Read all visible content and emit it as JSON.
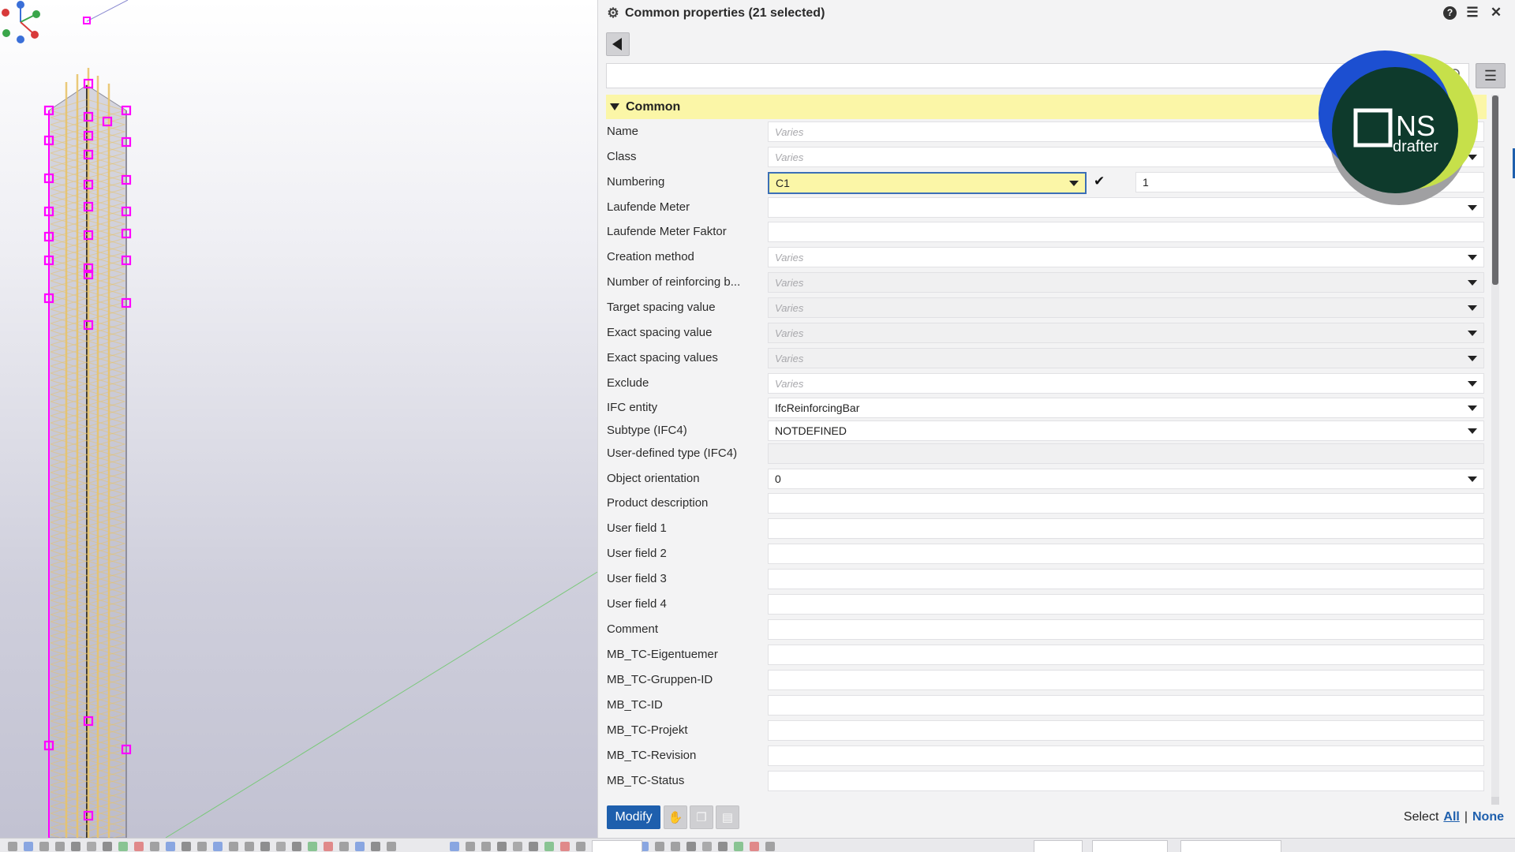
{
  "panel": {
    "title": "Common properties (21 selected)",
    "icons": [
      "gear-icon",
      "help-icon",
      "list-view-icon",
      "close-icon"
    ]
  },
  "search": {
    "placeholder": "",
    "icon": "search-icon"
  },
  "section": {
    "title": "Common",
    "expanded": true
  },
  "fields": [
    {
      "label": "Name",
      "value": "Varies",
      "varies": true,
      "dropdown": true
    },
    {
      "label": "Class",
      "value": "Varies",
      "varies": true,
      "dropdown": true
    },
    {
      "label": "Numbering",
      "prefix": "C1",
      "start": "1"
    },
    {
      "label": "Laufende Meter",
      "value": "",
      "dropdown": true
    },
    {
      "label": "Laufende Meter Faktor",
      "value": ""
    },
    {
      "label": "Creation method",
      "value": "Varies",
      "varies": true,
      "dropdown": true
    },
    {
      "label": "Number of reinforcing b...",
      "value": "Varies",
      "varies": true,
      "dropdown": true,
      "disabled": true
    },
    {
      "label": "Target spacing value",
      "value": "Varies",
      "varies": true,
      "dropdown": true,
      "disabled": true
    },
    {
      "label": "Exact spacing value",
      "value": "Varies",
      "varies": true,
      "dropdown": true,
      "disabled": true
    },
    {
      "label": "Exact spacing values",
      "value": "Varies",
      "varies": true,
      "dropdown": true,
      "disabled": true
    },
    {
      "label": "Exclude",
      "value": "Varies",
      "varies": true,
      "dropdown": true
    },
    {
      "label": "IFC entity",
      "value": "IfcReinforcingBar",
      "dropdown": true
    },
    {
      "label": "Subtype (IFC4)",
      "value": "NOTDEFINED",
      "dropdown": true
    },
    {
      "label": "User-defined type (IFC4)",
      "value": "",
      "disabled": true
    },
    {
      "label": "Object orientation",
      "value": "0",
      "dropdown": true
    },
    {
      "label": "Product description",
      "value": ""
    },
    {
      "label": "User field 1",
      "value": ""
    },
    {
      "label": "User field 2",
      "value": ""
    },
    {
      "label": "User field 3",
      "value": ""
    },
    {
      "label": "User field 4",
      "value": ""
    },
    {
      "label": "Comment",
      "value": ""
    },
    {
      "label": "MB_TC-Eigentuemer",
      "value": ""
    },
    {
      "label": "MB_TC-Gruppen-ID",
      "value": ""
    },
    {
      "label": "MB_TC-ID",
      "value": ""
    },
    {
      "label": "MB_TC-Projekt",
      "value": ""
    },
    {
      "label": "MB_TC-Revision",
      "value": ""
    },
    {
      "label": "MB_TC-Status",
      "value": ""
    }
  ],
  "footer": {
    "modify_label": "Modify",
    "select_label": "Select",
    "all_label": "All",
    "separator": "|",
    "none_label": "None"
  },
  "logo": {
    "line1": "NS",
    "line2": "drafter"
  },
  "colors": {
    "accent": "#1e5fad",
    "section_highlight": "#fbf6a7",
    "rebar": "#e8c36a",
    "handle": "#ff00ff"
  }
}
